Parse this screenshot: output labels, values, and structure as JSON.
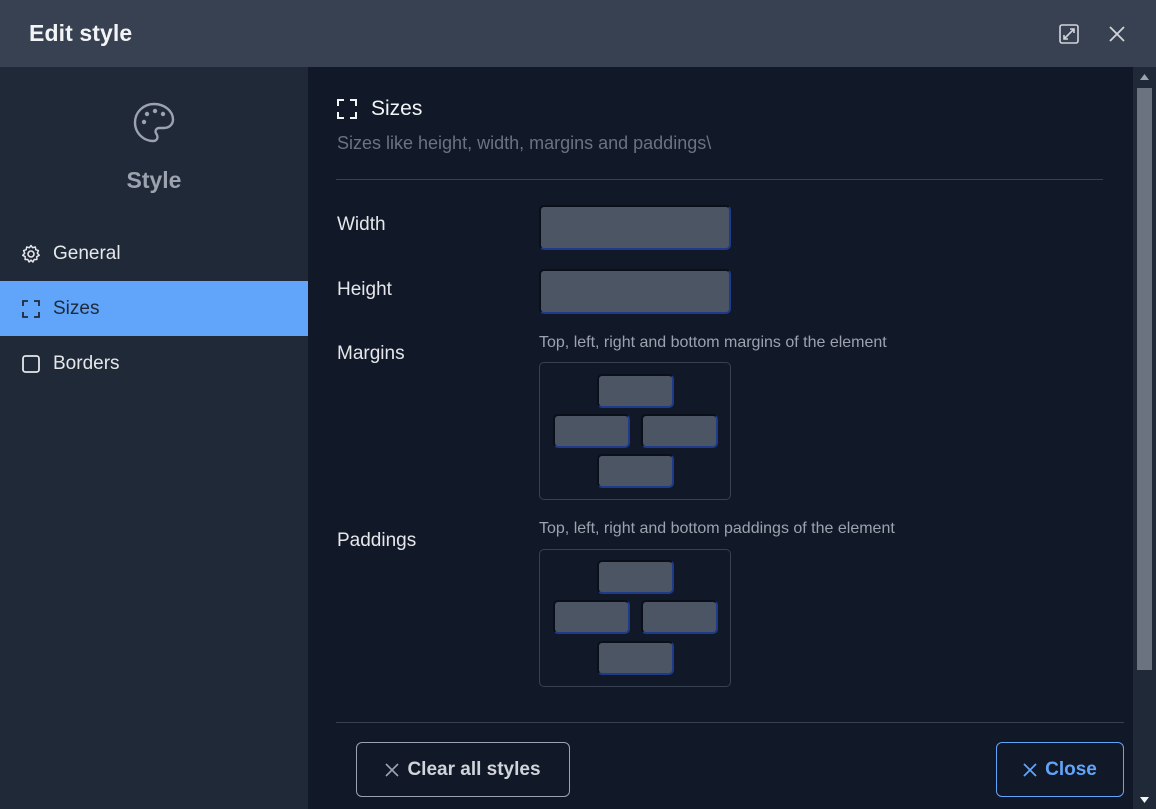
{
  "header": {
    "title": "Edit style",
    "expand_icon": "expand-icon",
    "close_icon": "close-icon"
  },
  "sidebar": {
    "hero_icon": "palette-icon",
    "hero_title": "Style",
    "items": [
      {
        "label": "General",
        "icon": "gear-icon",
        "active": false
      },
      {
        "label": "Sizes",
        "icon": "frame-corners-icon",
        "active": true
      },
      {
        "label": "Borders",
        "icon": "square-icon",
        "active": false
      }
    ]
  },
  "section": {
    "icon": "frame-corners-icon",
    "title": "Sizes",
    "description": "Sizes like height, width, margins and paddings\\"
  },
  "fields": {
    "width": {
      "label": "Width",
      "value": ""
    },
    "height": {
      "label": "Height",
      "value": ""
    },
    "margins": {
      "label": "Margins",
      "hint": "Top, left, right and bottom margins of the element",
      "top": "",
      "left": "",
      "right": "",
      "bottom": ""
    },
    "paddings": {
      "label": "Paddings",
      "hint": "Top, left, right and bottom paddings of the element",
      "top": "",
      "left": "",
      "right": "",
      "bottom": ""
    }
  },
  "footer": {
    "clear_label": "Clear all styles",
    "close_label": "Close"
  },
  "colors": {
    "accent": "#60a5fa",
    "header_bg": "#374151",
    "sidebar_bg": "#1f2937",
    "main_bg": "#111827",
    "input_bg": "#4b5563"
  }
}
